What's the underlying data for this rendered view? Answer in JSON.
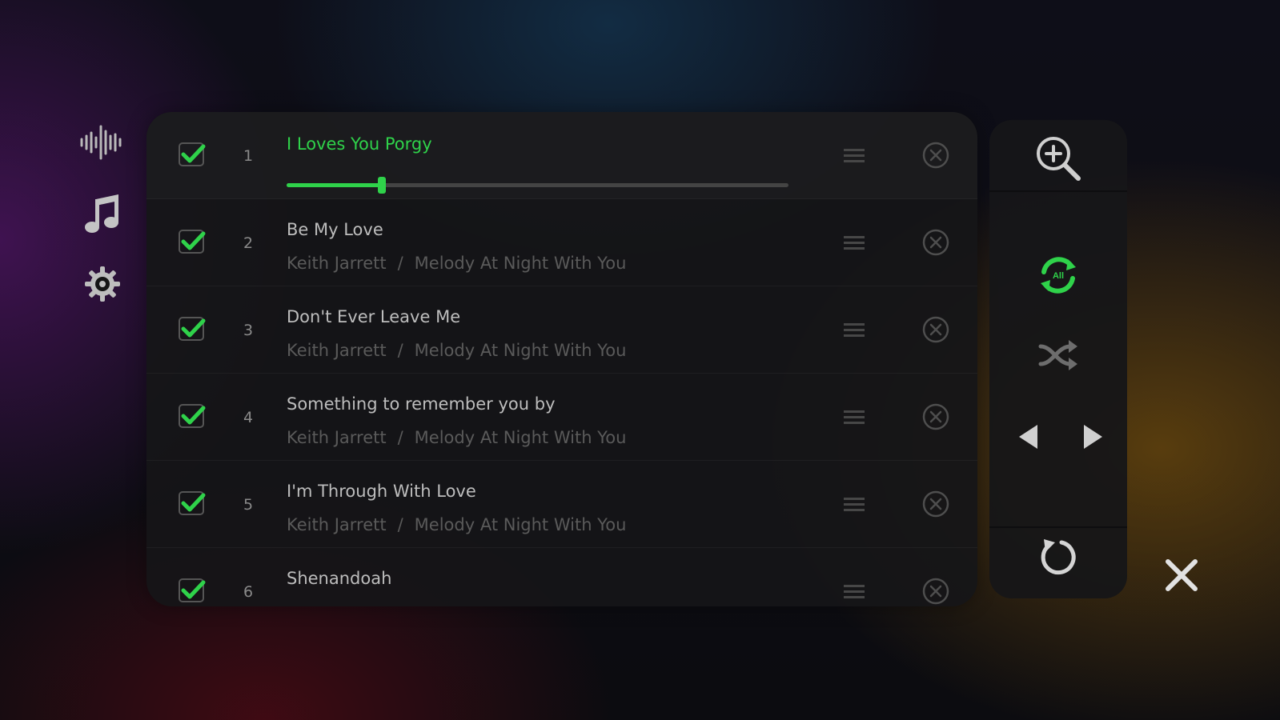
{
  "theme": {
    "accent": "#2fd24a",
    "text": "#bdbdbd",
    "muted": "#5a5a5a",
    "icon": "#b9b9b9"
  },
  "nav": {
    "items": [
      {
        "name": "waveform-icon"
      },
      {
        "name": "music-note-icon"
      },
      {
        "name": "gear-icon"
      }
    ]
  },
  "playlist": {
    "current_progress_fraction": 0.19,
    "separator": "/",
    "tracks": [
      {
        "number": "1",
        "title": "I Loves You Porgy",
        "artist": "",
        "album": "",
        "checked": true,
        "playing": true
      },
      {
        "number": "2",
        "title": "Be My Love",
        "artist": "Keith Jarrett",
        "album": "Melody At Night With You",
        "checked": true
      },
      {
        "number": "3",
        "title": "Don't Ever Leave Me",
        "artist": "Keith Jarrett",
        "album": "Melody At Night With You",
        "checked": true
      },
      {
        "number": "4",
        "title": "Something to remember you by",
        "artist": "Keith Jarrett",
        "album": "Melody At Night With You",
        "checked": true
      },
      {
        "number": "5",
        "title": "I'm Through With Love",
        "artist": "Keith Jarrett",
        "album": "Melody At Night With You",
        "checked": true
      },
      {
        "number": "6",
        "title": "Shenandoah",
        "artist": "",
        "album": "",
        "checked": true
      }
    ]
  },
  "controls": {
    "repeat_mode_label": "All",
    "icons": [
      "zoom-in-icon",
      "repeat-all-icon",
      "shuffle-icon",
      "previous-icon",
      "next-icon",
      "refresh-icon"
    ]
  },
  "close": {
    "icon": "close-icon"
  }
}
